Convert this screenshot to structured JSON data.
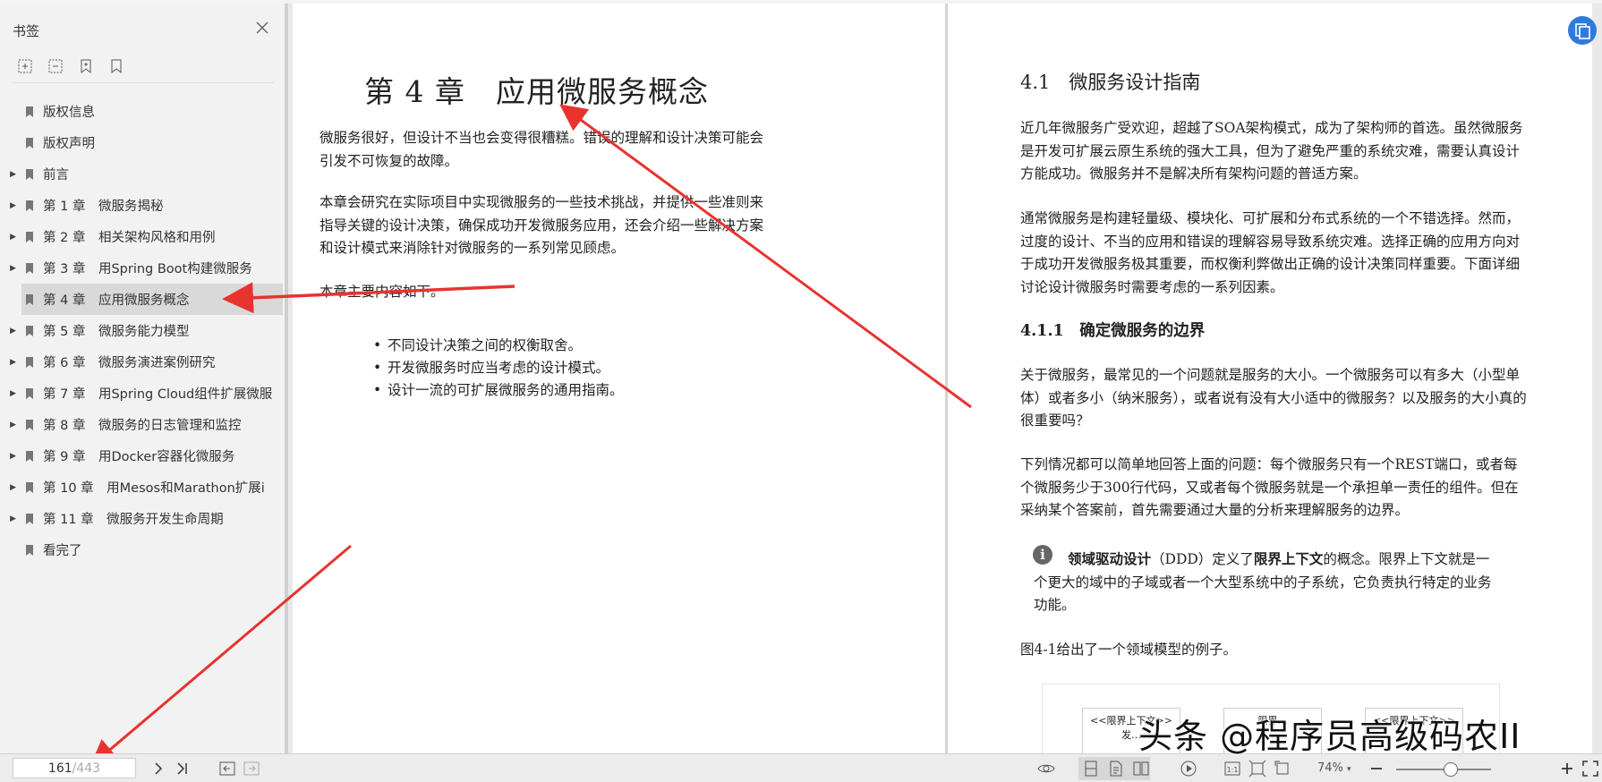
{
  "sidebar": {
    "title": "书签",
    "items": [
      {
        "label": "版权信息",
        "expandable": false
      },
      {
        "label": "版权声明",
        "expandable": false
      },
      {
        "label": "前言",
        "expandable": true
      },
      {
        "label": "第 1 章　微服务揭秘",
        "expandable": true
      },
      {
        "label": "第 2 章　相关架构风格和用例",
        "expandable": true
      },
      {
        "label": "第 3 章　用Spring Boot构建微服务",
        "expandable": true
      },
      {
        "label": "第 4 章　应用微服务概念",
        "expandable": true,
        "selected": true
      },
      {
        "label": "第 5 章　微服务能力模型",
        "expandable": true
      },
      {
        "label": "第 6 章　微服务演进案例研究",
        "expandable": true
      },
      {
        "label": "第 7 章　用Spring Cloud组件扩展微服",
        "expandable": true
      },
      {
        "label": "第 8 章　微服务的日志管理和监控",
        "expandable": true
      },
      {
        "label": "第 9 章　用Docker容器化微服务",
        "expandable": true
      },
      {
        "label": "第 10 章　用Mesos和Marathon扩展i",
        "expandable": true
      },
      {
        "label": "第 11 章　微服务开发生命周期",
        "expandable": true
      },
      {
        "label": "看完了",
        "expandable": false
      }
    ]
  },
  "left_page": {
    "chapter_title": "第 4 章　应用微服务概念",
    "p1": "微服务很好，但设计不当也会变得很糟糕。错误的理解和设计决策可能会引发不可恢复的故障。",
    "p2": "本章会研究在实际项目中实现微服务的一些技术挑战，并提供一些准则来指导关键的设计决策，确保成功开发微服务应用，还会介绍一些解决方案和设计模式来消除针对微服务的一系列常见顾虑。",
    "p3": "本章主要内容如下。",
    "bullets": [
      "不同设计决策之间的权衡取舍。",
      "开发微服务时应当考虑的设计模式。",
      "设计一流的可扩展微服务的通用指南。"
    ]
  },
  "right_page": {
    "h2": "4.1　微服务设计指南",
    "p1": "近几年微服务广受欢迎，超越了SOA架构模式，成为了架构师的首选。虽然微服务是开发可扩展云原生系统的强大工具，但为了避免严重的系统灾难，需要认真设计方能成功。微服务并不是解决所有架构问题的普适方案。",
    "p2": "通常微服务是构建轻量级、模块化、可扩展和分布式系统的一个不错选择。然而，过度的设计、不当的应用和错误的理解容易导致系统灾难。选择正确的应用方向对于成功开发微服务极其重要，而权衡利弊做出正确的设计决策同样重要。下面详细讨论设计微服务时需要考虑的一系列因素。",
    "h3": "4.1.1　确定微服务的边界",
    "p3": "关于微服务，最常见的一个问题就是服务的大小。一个微服务可以有多大（小型单体）或者多小（纳米服务），或者说有没有大小适中的微服务？以及服务的大小真的很重要吗？",
    "p4": "下列情况都可以简单地回答上面的问题：每个微服务只有一个REST端口，或者每个微服务少于300行代码，又或者每个微服务就是一个承担单一责任的组件。但在采纳某个答案前，首先需要通过大量的分析来理解服务的边界。",
    "note_bold1": "领域驱动设计",
    "note_mid": "（DDD）定义了",
    "note_bold2": "限界上下文",
    "note_rest": "的概念。限界上下文就是一个更大的域中的子域或者一个大型系统中的子系统，它负责执行特定的业务功能。",
    "p5": "图4-1给出了一个领域模型的例子。",
    "fig_cells": [
      "<<限界上下文>>\n发…",
      "限界…",
      "<<限界上下文>>"
    ]
  },
  "toolbar": {
    "current_page": "161",
    "total_pages": "/443",
    "zoom": "74%"
  },
  "watermark": "头条 @程序员高级码农II",
  "colors": {
    "arrow": "#e8332f",
    "badge": "#2d7be0",
    "selected_bg": "#d9d9d9"
  }
}
